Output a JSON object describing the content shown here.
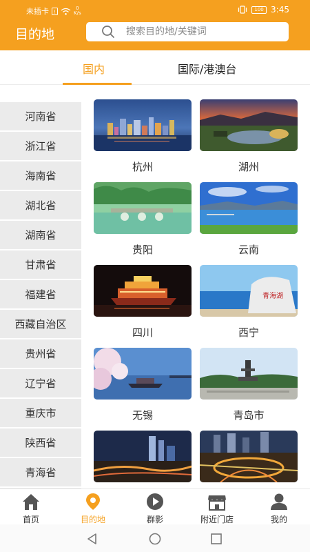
{
  "status_bar": {
    "carrier": "未插卡",
    "speed_value": "0",
    "speed_unit": "K/s",
    "battery": "100",
    "time": "3:45"
  },
  "header": {
    "title": "目的地"
  },
  "search": {
    "placeholder": "搜索目的地/关键词"
  },
  "tabs": [
    {
      "label": "国内",
      "active": true
    },
    {
      "label": "国际/港澳台",
      "active": false
    }
  ],
  "provinces": [
    "河南省",
    "浙江省",
    "海南省",
    "湖北省",
    "湖南省",
    "甘肃省",
    "福建省",
    "西藏自治区",
    "贵州省",
    "辽宁省",
    "重庆市",
    "陕西省",
    "青海省"
  ],
  "cities": [
    {
      "name": "杭州"
    },
    {
      "name": "湖州"
    },
    {
      "name": "贵阳"
    },
    {
      "name": "云南"
    },
    {
      "name": "四川"
    },
    {
      "name": "西宁"
    },
    {
      "name": "无锡"
    },
    {
      "name": "青岛市"
    },
    {
      "name": ""
    },
    {
      "name": ""
    }
  ],
  "city_badge_text": "青海湖",
  "bottom_nav": [
    {
      "label": "首页",
      "icon": "home-icon"
    },
    {
      "label": "目的地",
      "icon": "location-pin-icon",
      "active": true
    },
    {
      "label": "群影",
      "icon": "play-icon"
    },
    {
      "label": "附近门店",
      "icon": "store-icon"
    },
    {
      "label": "我的",
      "icon": "user-icon"
    }
  ],
  "colors": {
    "accent": "#f5a01f",
    "sidebar_bg": "#ebebeb"
  }
}
